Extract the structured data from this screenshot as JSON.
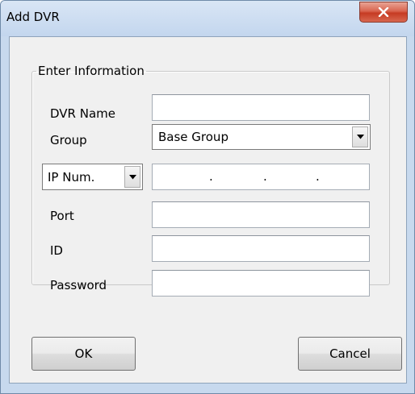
{
  "window": {
    "title": "Add DVR",
    "close_glyph": "✕"
  },
  "group": {
    "legend": "Enter Information"
  },
  "fields": {
    "dvr_name": {
      "label": "DVR Name",
      "value": ""
    },
    "group": {
      "label": "Group",
      "selected": "Base Group"
    },
    "ip_type": {
      "selected": "IP Num."
    },
    "ip_address": {
      "octets": [
        "",
        "",
        "",
        ""
      ],
      "separator": "."
    },
    "port": {
      "label": "Port",
      "value": ""
    },
    "id": {
      "label": "ID",
      "value": ""
    },
    "password": {
      "label": "Password",
      "value": ""
    }
  },
  "buttons": {
    "ok": "OK",
    "cancel": "Cancel"
  },
  "colors": {
    "close_button": "#c63b23",
    "title_bar": "#c3d6ee",
    "dialog_background": "#f0f0f0"
  },
  "icons": {
    "close": "close-icon",
    "dropdown": "chevron-down-icon"
  }
}
